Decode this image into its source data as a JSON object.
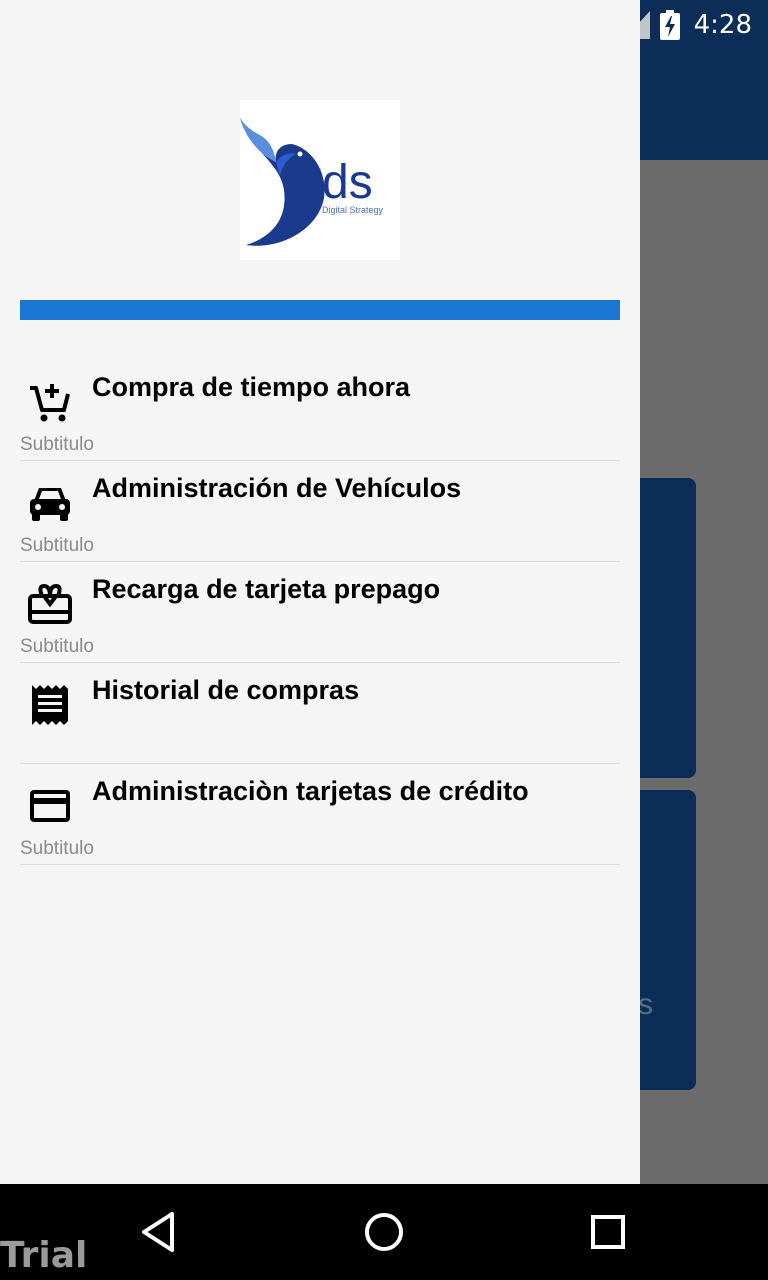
{
  "status_bar": {
    "time": "4:28",
    "icons": [
      "wifi-icon",
      "signal-icon",
      "battery-charging-icon"
    ]
  },
  "background": {
    "card_partial_text": "s"
  },
  "drawer": {
    "logo": {
      "text": "ds",
      "tagline": "Digital Strategy"
    },
    "menu": [
      {
        "icon": "cart-add-icon",
        "title": "Compra de tiempo ahora",
        "subtitle": "Subtitulo"
      },
      {
        "icon": "car-icon",
        "title": "Administración de Vehículos",
        "subtitle": "Subtitulo"
      },
      {
        "icon": "gift-card-icon",
        "title": "Recarga de tarjeta prepago",
        "subtitle": "Subtitulo"
      },
      {
        "icon": "receipt-icon",
        "title": "Historial de compras",
        "subtitle": ""
      },
      {
        "icon": "credit-card-icon",
        "title": "Administraciòn tarjetas de crédito",
        "subtitle": "Subtitulo"
      }
    ]
  },
  "nav_bar": {
    "buttons": [
      "back-icon",
      "home-icon",
      "recents-icon"
    ]
  },
  "watermark": "Trial",
  "colors": {
    "appbar": "#0c2d57",
    "drawer_bg": "#f5f5f5",
    "accent_bar": "#1976d2",
    "subtitle": "#8a8a8a"
  }
}
